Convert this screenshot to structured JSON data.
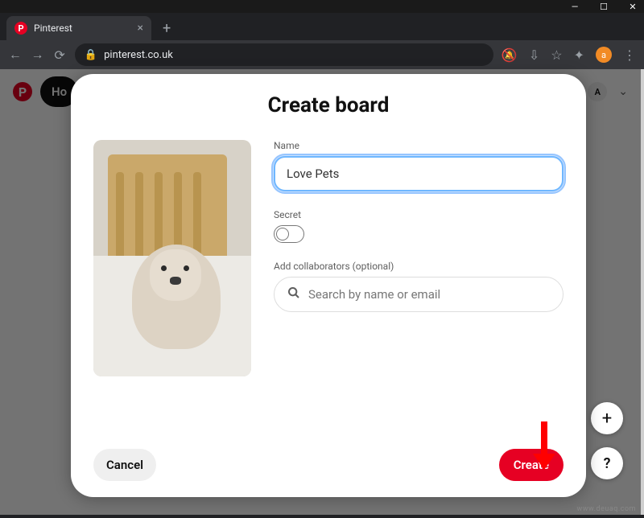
{
  "window": {
    "minimize": "—",
    "maximize": "☐",
    "close": "✕"
  },
  "browser": {
    "tab_title": "Pinterest",
    "tab_favicon_letter": "P",
    "new_tab": "+",
    "nav": {
      "back": "←",
      "forward": "→",
      "reload": "⟳"
    },
    "lock": "🔒",
    "url": "pinterest.co.uk",
    "right_icons": {
      "mute": "🔕",
      "install": "⇩",
      "star": "☆",
      "ext": "✦",
      "avatar_letter": "a",
      "menu": "⋮"
    }
  },
  "pinterest": {
    "logo_letter": "P",
    "home_label": "Ho",
    "avatar_letter": "A",
    "chevron": "⌄"
  },
  "modal": {
    "title": "Create board",
    "name_label": "Name",
    "name_value": "Love Pets",
    "secret_label": "Secret",
    "collab_label": "Add collaborators (optional)",
    "collab_placeholder": "Search by name or email",
    "cancel_label": "Cancel",
    "create_label": "Create",
    "secret_on": false
  },
  "fab": {
    "plus": "+",
    "help": "?"
  },
  "annotation": {
    "arrow_color": "#ff0000"
  }
}
